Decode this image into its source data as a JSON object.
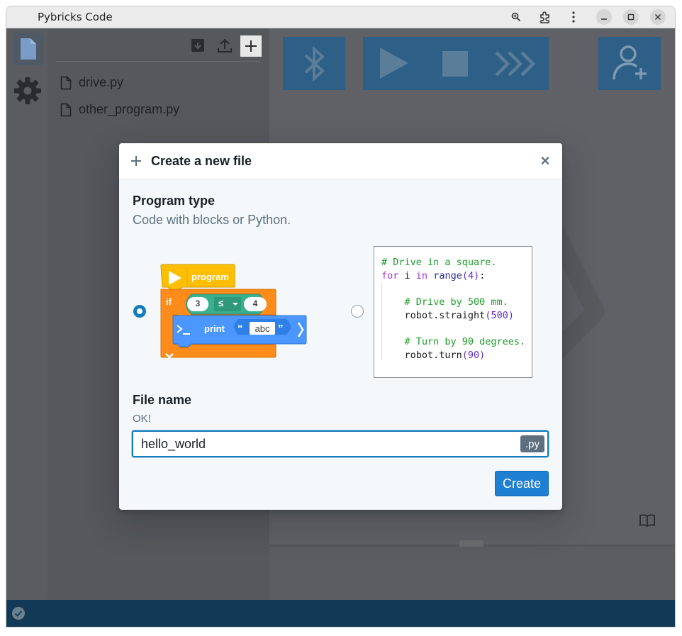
{
  "window": {
    "title": "Pybricks Code"
  },
  "explorer": {
    "files": [
      {
        "name": "drive.py"
      },
      {
        "name": "other_program.py"
      }
    ]
  },
  "dialog": {
    "title": "Create a new file",
    "program_type": {
      "heading": "Program type",
      "subtitle": "Code with blocks or Python.",
      "options": [
        {
          "kind": "blocks",
          "selected": true
        },
        {
          "kind": "python",
          "selected": false
        }
      ],
      "blocks_preview": {
        "start_label": "program",
        "if_label": "if",
        "left_operand": "3",
        "operator": "≤",
        "right_operand": "4",
        "print_label": "print",
        "open_quote": "“",
        "string_value": "abc",
        "close_quote": "”"
      },
      "python_preview": {
        "lines": [
          "# Drive in a square.",
          "for i in range(4):",
          "",
          "    # Drive by 500 mm.",
          "    robot.straight(500)",
          "",
          "    # Turn by 90 degrees.",
          "    robot.turn(90)"
        ]
      }
    },
    "file_name": {
      "heading": "File name",
      "status": "OK!",
      "value": "hello_world",
      "extension": ".py"
    },
    "create_label": "Create",
    "close_glyph": "×"
  },
  "colors": {
    "accent": "#137cbd",
    "toolbar_button": "#2d5f87",
    "statusbar": "#123a56",
    "block_yellow": "#ffbf00",
    "block_orange": "#ff8c1a",
    "block_green": "#3bb08f",
    "block_blue": "#4c97ff"
  }
}
